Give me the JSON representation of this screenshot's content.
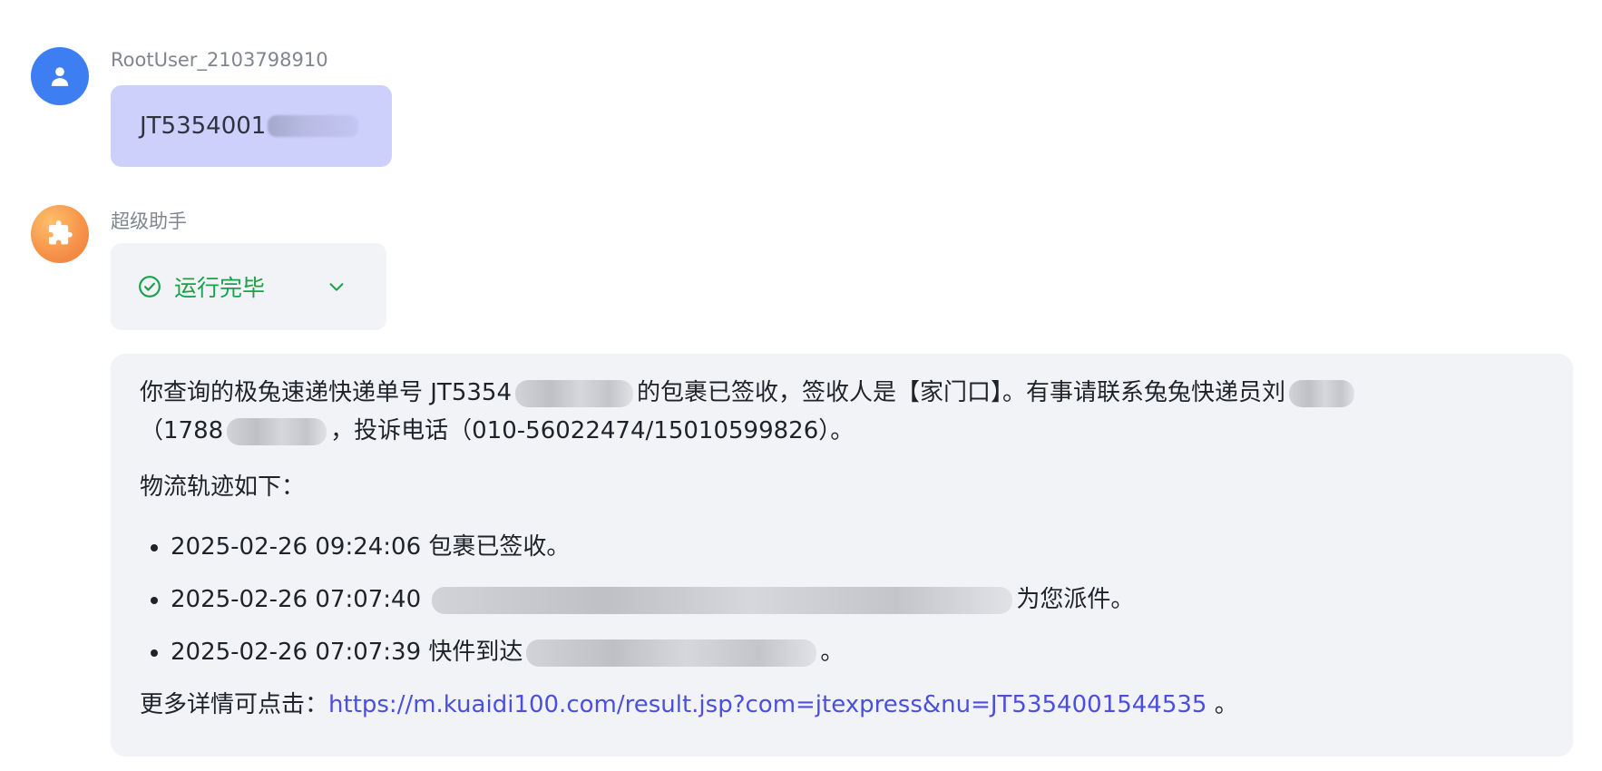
{
  "user_message": {
    "sender": "RootUser_2103798910",
    "text": "JT5354001"
  },
  "assistant": {
    "sender": "超级助手",
    "status_text": "运行完毕",
    "intro_a": "你查询的极兔速递快递单号 JT5354",
    "intro_b": "的包裹已签收，签收人是【家门口】。有事请联系兔兔快递员刘",
    "intro_c": "（1788",
    "intro_d": "，投诉电话（010-56022474/15010599826）。",
    "track_title": "物流轨迹如下：",
    "tracks": [
      {
        "time": "2025-02-26 09:24:06",
        "desc": "包裹已签收。"
      },
      {
        "time": "2025-02-26 07:07:40",
        "desc": "为您派件。"
      },
      {
        "time": "2025-02-26 07:07:39",
        "desc": "快件到达"
      }
    ],
    "track_3_suffix": "。",
    "more_prefix": "更多详情可点击：",
    "more_link": "https://m.kuaidi100.com/result.jsp?com=jtexpress&nu=JT5354001544535",
    "more_suffix": " 。"
  },
  "colors": {
    "user_avatar": "#3d7ef3",
    "user_bubble": "#cdd0fa",
    "status_green": "#17a34a",
    "card_bg": "#f2f3f7",
    "link": "#4a4fe0"
  },
  "icons": {
    "user_avatar": "user-icon",
    "bot_avatar": "puzzle-icon",
    "status": "check-circle-icon",
    "toggle": "chevron-down-icon"
  }
}
